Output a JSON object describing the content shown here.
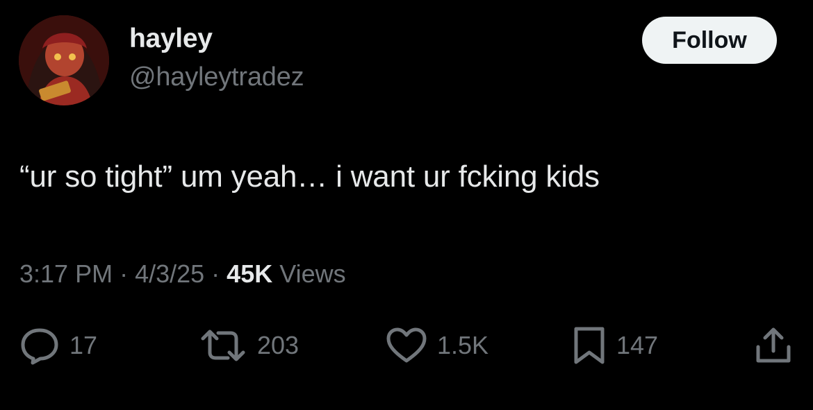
{
  "author": {
    "display_name": "hayley",
    "handle": "@hayleytradez",
    "avatar_icon": "profile-avatar-anime-character"
  },
  "follow_label": "Follow",
  "tweet": {
    "text": "“ur so tight” um yeah… i want ur fcking kids"
  },
  "meta": {
    "time": "3:17 PM",
    "separator": "·",
    "date": "4/3/25",
    "views_count": "45K",
    "views_label": "Views"
  },
  "actions": {
    "replies": "17",
    "reposts": "203",
    "likes": "1.5K",
    "bookmarks": "147"
  },
  "colors": {
    "background": "#000000",
    "primary_text": "#e7e9ea",
    "secondary_text": "#71767b",
    "follow_button_bg": "#eff3f4",
    "follow_button_text": "#0f1419"
  }
}
